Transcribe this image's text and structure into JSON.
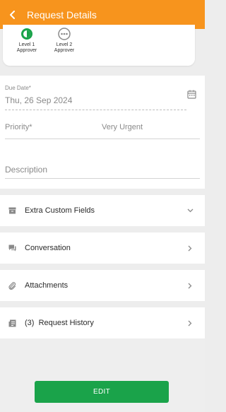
{
  "header": {
    "title": "Request Details",
    "background": "#f7941d"
  },
  "approvers": [
    {
      "level": "Level 1",
      "role": "Approver",
      "status": "in-progress",
      "color": "#1aa34a"
    },
    {
      "level": "Level 2",
      "role": "Approver",
      "status": "pending",
      "color": "#8a8a8a"
    }
  ],
  "form": {
    "due_date_label": "Due Date*",
    "due_date_value": "Thu, 26 Sep 2024",
    "priority_label": "Priority*",
    "priority_value": "Very Urgent",
    "description_placeholder": "Description"
  },
  "sections": {
    "extra_fields": "Extra Custom Fields",
    "conversation": "Conversation",
    "attachments": "Attachments",
    "history_count": "(3)",
    "history_label": "Request History"
  },
  "footer": {
    "edit_label": "EDIT",
    "edit_color": "#1aa34a"
  }
}
